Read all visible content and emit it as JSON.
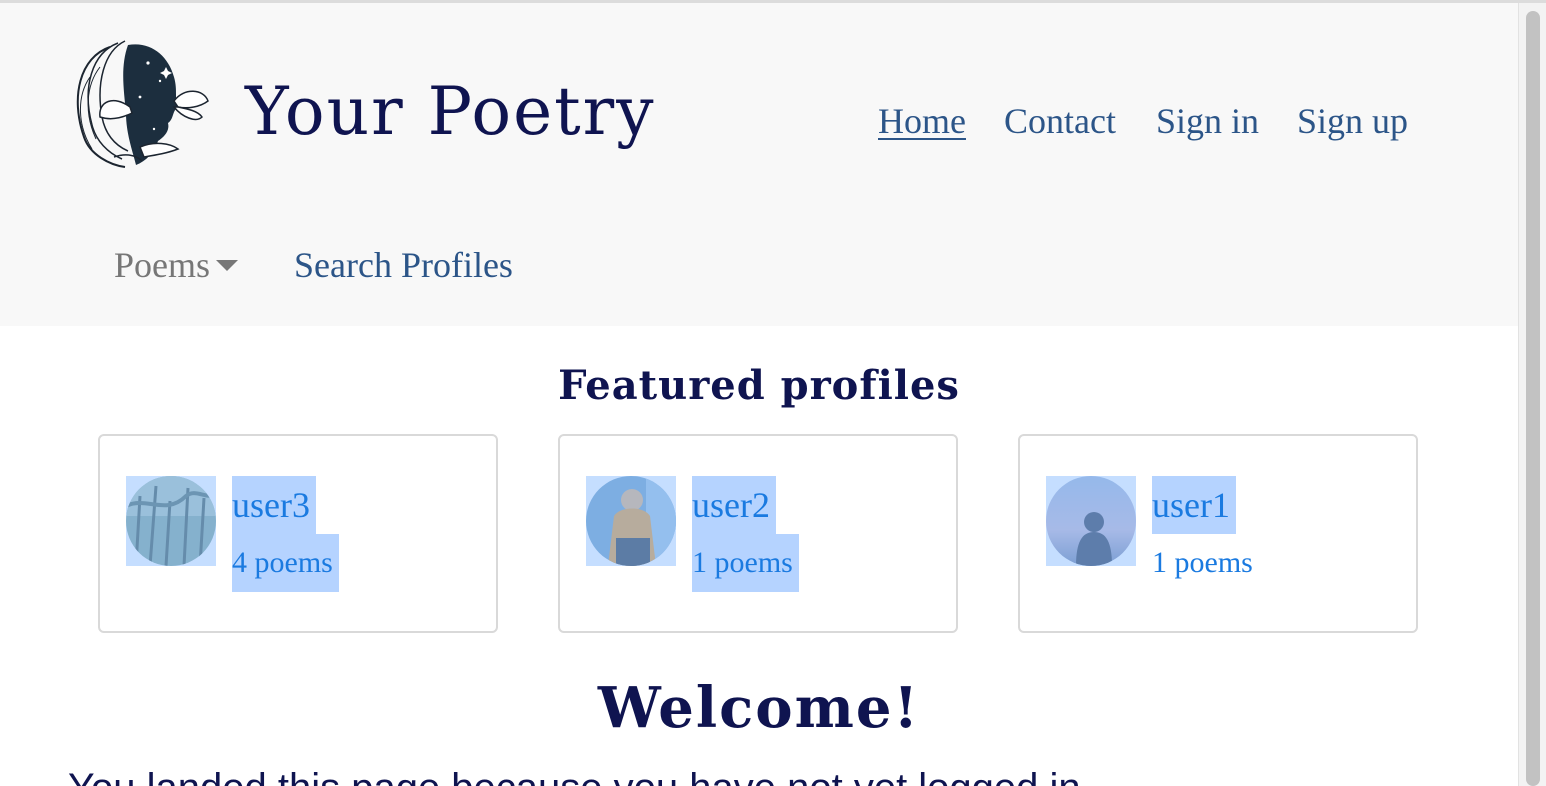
{
  "brand": {
    "title": "Your Poetry"
  },
  "nav": {
    "home": "Home",
    "contact": "Contact",
    "signin": "Sign in",
    "signup": "Sign up"
  },
  "subnav": {
    "poems": "Poems",
    "search_profiles": "Search Profiles"
  },
  "featured": {
    "title": "Featured profiles",
    "profiles": [
      {
        "username": "user3",
        "poems": "4 poems"
      },
      {
        "username": "user2",
        "poems": "1 poems"
      },
      {
        "username": "user1",
        "poems": "1 poems"
      }
    ]
  },
  "welcome": {
    "title": "Welcome!",
    "intro": "You landed this page because you have not yet logged in."
  },
  "colors": {
    "brand": "#0f1450",
    "nav_link": "#2c5588",
    "profile_link": "#1a7ae0",
    "header_bg": "#f8f8f8"
  }
}
